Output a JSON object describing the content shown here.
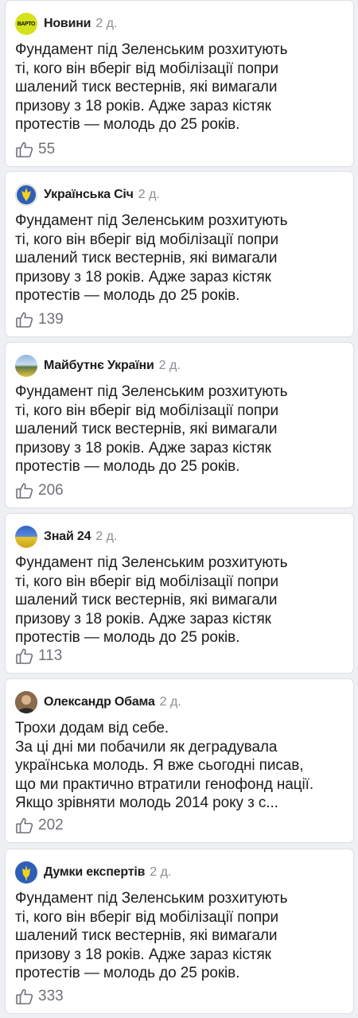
{
  "posts": [
    {
      "author": "Новини",
      "time": "2 д.",
      "avatar": "varto-logo-avatar",
      "avatar_text": "ВАРТО",
      "text": "Фундамент під Зеленським розхитують\nті, кого він вберіг від мобілізації попри\nшалений тиск вестернів, які вимагали\nпризову з 18 років. Адже зараз кістяк\nпротестів — молодь до 25 років.",
      "likes": "55"
    },
    {
      "author": "Українська Січ",
      "time": "2 д.",
      "avatar": "sich-emblem-avatar",
      "text": "Фундамент під Зеленським розхитують\nті, кого він вберіг від мобілізації попри\nшалений тиск вестернів, які вимагали\nпризову з 18 років. Адже зараз кістяк\nпротестів — молодь до 25 років.",
      "likes": "139"
    },
    {
      "author": "Майбутнє України",
      "time": "2 д.",
      "avatar": "landscape-photo-avatar",
      "text": "Фундамент під Зеленським розхитують\nті, кого він вберіг від мобілізації попри\nшалений тиск вестернів, які вимагали\nпризову з 18 років. Адже зараз кістяк\nпротестів — молодь до 25 років.",
      "likes": "206"
    },
    {
      "author": "Знай 24",
      "time": "2 д.",
      "avatar": "wheat-field-avatar",
      "text": "Фундамент під Зеленським розхитують\nті, кого він вберіг від мобілізації попри\nшалений тиск вестернів, які вимагали\nпризову з 18 років. Адже зараз кістяк\nпротестів — молодь до 25 років.",
      "likes": "113"
    },
    {
      "author": "Олександр Обама",
      "time": "2 д.",
      "avatar": "person-photo-avatar",
      "text": "Трохи додам від себе.\nЗа ці дні ми побачили як деградувала\nукраїнська молодь. Я вже сьогодні писав,\nщо ми практично втратили генофонд нації.\nЯкщо зрівняти молодь 2014 року з с...",
      "likes": "202"
    },
    {
      "author": "Думки експертів",
      "time": "2 д.",
      "avatar": "trident-avatar",
      "text": "Фундамент під Зеленським розхитують\nті, кого він вберіг від мобілізації попри\nшалений тиск вестернів, які вимагали\nпризову з 18 років. Адже зараз кістяк\nпротестів — молодь до 25 років.",
      "likes": "333"
    }
  ],
  "colors": {
    "background": "#eef0f3",
    "card": "#ffffff",
    "text": "#1c1c1e",
    "muted": "#8a8d93",
    "varto_yellow": "#d4e21a",
    "ukraine_blue": "#2d5fb8",
    "ukraine_yellow": "#f3d21c"
  }
}
